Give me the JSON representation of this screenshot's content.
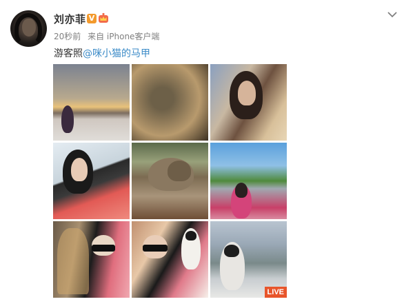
{
  "post": {
    "username": "刘亦菲",
    "verified_badge": "V",
    "time": "20秒前",
    "source": "来自 iPhone客户端",
    "caption_text": "游客照",
    "caption_mention": "@咪小猫的马甲",
    "live_label": "LIVE"
  },
  "icons": {
    "verified": "verified-v-icon",
    "vip": "crown-vip-icon",
    "menu": "chevron-down-icon"
  },
  "colors": {
    "mention": "#3a8ac7",
    "badge": "#f39a2d",
    "live": "#e8552b",
    "text": "#333333",
    "meta": "#808080"
  },
  "photos": [
    "sunset-beach-photo",
    "dry-grass-closeup-photo",
    "woman-in-grass-photo",
    "woman-pink-coat-photo",
    "tabby-cat-photo",
    "street-selfie-photo",
    "birdcage-sunglasses-photo",
    "sheep-toy-selfie-photo",
    "window-sheep-toy-photo"
  ]
}
